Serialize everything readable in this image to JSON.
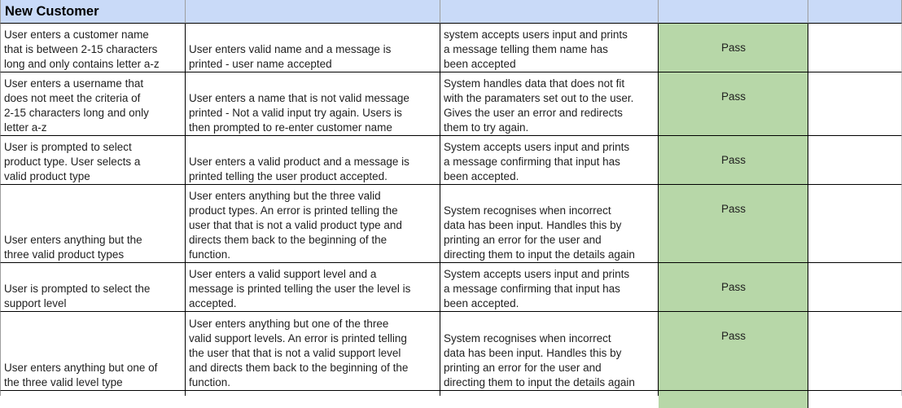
{
  "sheet": {
    "section_title": "New Customer",
    "rows": [
      {
        "input": "User enters a customer name\nthat is between 2-15 characters\nlong and only contains letter a-z",
        "expected": "User enters valid name and a message is\nprinted - user name accepted",
        "actual": "system accepts users input and prints\na message telling them name has\nbeen accepted",
        "result": "Pass"
      },
      {
        "input": "User enters a username that\ndoes not meet the criteria of\n2-15 characters long and only\nletter a-z",
        "expected": "User enters a name that is not valid message\nprinted - Not a valid input try again. Users is\nthen prompted to re-enter customer name",
        "actual": "System handles data that does not fit\nwith the paramaters set out to the user.\nGives the user an error and redirects\nthem to try again.",
        "result": "Pass"
      },
      {
        "input": "User is prompted to select\nproduct type. User selects a\nvalid product type",
        "expected": "User enters a valid product and a message is\nprinted telling the user product accepted.",
        "actual": "System accepts users input and prints\na message confirming that input has\nbeen accepted.",
        "result": "Pass"
      },
      {
        "input": "User enters anything but the\nthree valid product types",
        "expected": "User enters anything but the three valid\nproduct types. An error is printed telling the\nuser that that is not a valid product type and\ndirects them back to the beginning of the\nfunction.",
        "actual": "System recognises when incorrect\ndata has been input. Handles this by\nprinting an error for the user and\ndirecting them to input the details again",
        "result": "Pass"
      },
      {
        "input": "User is prompted to select the\nsupport level",
        "expected": "User enters a valid support level and a\nmessage is printed telling the user the level is\naccepted.",
        "actual": "System accepts users input and prints\na message confirming that input has\nbeen accepted.",
        "result": "Pass"
      },
      {
        "input": "User enters anything but one of\nthe three valid level type",
        "expected": "User enters anything but one of the three\nvalid support levels. An error is printed telling\nthe user that that is not a valid  support level\nand directs them back to the beginning of the\nfunction.",
        "actual": "System recognises when incorrect\ndata has been input. Handles this by\nprinting an error for the user and\ndirecting them to input the details again",
        "result": "Pass"
      }
    ]
  }
}
